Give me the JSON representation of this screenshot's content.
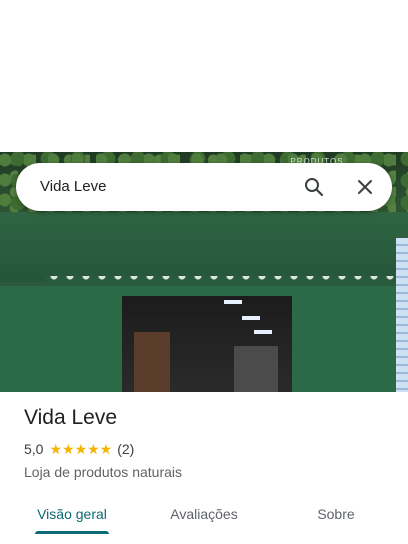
{
  "search": {
    "query": "Vida Leve"
  },
  "place": {
    "name": "Vida Leve",
    "rating": "5,0",
    "stars": "★★★★★",
    "review_count": "(2)",
    "category": "Loja de produtos naturais"
  },
  "photo": {
    "sign_text": "PRODUTOS NATURAIS"
  },
  "tabs": [
    {
      "label": "Visão geral",
      "active": true
    },
    {
      "label": "Avaliações",
      "active": false
    },
    {
      "label": "Sobre",
      "active": false
    }
  ],
  "colors": {
    "accent": "#0b6a73",
    "star": "#f4b400",
    "storefront_green": "#2b6a47"
  }
}
